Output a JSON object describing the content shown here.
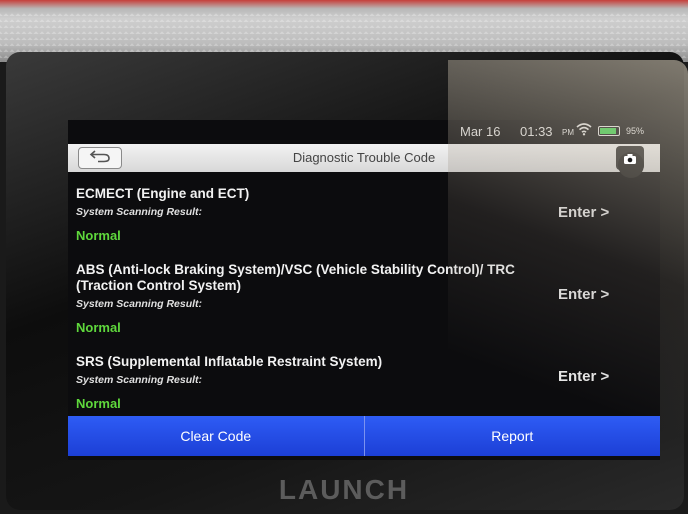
{
  "status": {
    "date": "Mar 16",
    "time": "01:33",
    "ampm": "PM",
    "wifi_icon": "wifi-icon",
    "battery_level": 0.95,
    "battery_text": "95%"
  },
  "header": {
    "title": "Diagnostic Trouble Code",
    "back_icon": "back-arrow-icon",
    "camera_icon": "camera-icon"
  },
  "systems": [
    {
      "name": "ECMECT (Engine and ECT)",
      "label": "System Scanning Result:",
      "status": "Normal",
      "enter": "Enter >"
    },
    {
      "name": "ABS (Anti-lock Braking System)/VSC (Vehicle Stability Control)/ TRC (Traction Control System)",
      "label": "System Scanning Result:",
      "status": "Normal",
      "enter": "Enter >"
    },
    {
      "name": "SRS (Supplemental Inflatable Restraint System)",
      "label": "System Scanning Result:",
      "status": "Normal",
      "enter": "Enter >"
    }
  ],
  "footer": {
    "clear_code": "Clear Code",
    "report": "Report"
  },
  "device": {
    "brand": "LAUNCH"
  },
  "colors": {
    "status_normal": "#5fd83c",
    "action_bar": "#2449e6"
  }
}
